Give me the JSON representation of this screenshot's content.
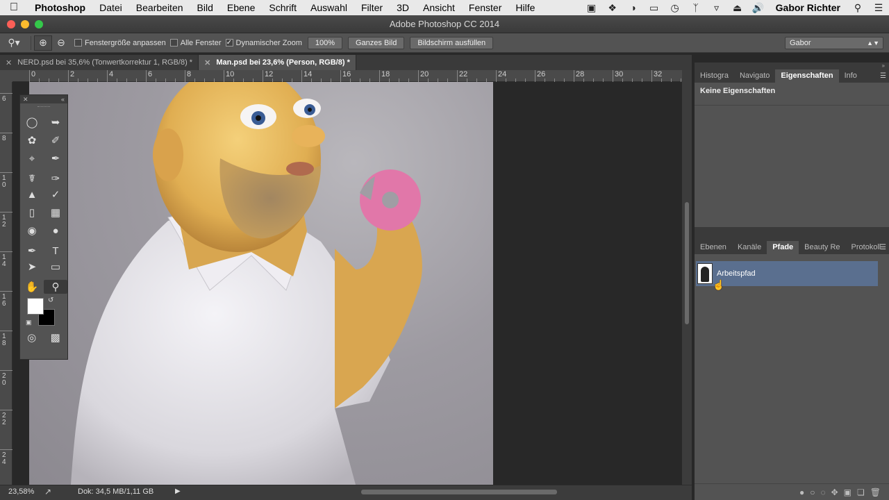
{
  "menubar": {
    "app": "Photoshop",
    "items": [
      "Datei",
      "Bearbeiten",
      "Bild",
      "Ebene",
      "Schrift",
      "Auswahl",
      "Filter",
      "3D",
      "Ansicht",
      "Fenster",
      "Hilfe"
    ],
    "user": "Gabor Richter",
    "tray_icons": [
      "menu-extra-icon",
      "dropbox-icon",
      "sync-icon",
      "airplay-icon",
      "time-machine-icon",
      "bluetooth-icon",
      "wifi-icon",
      "eject-icon",
      "volume-icon"
    ]
  },
  "window": {
    "title": "Adobe Photoshop CC 2014"
  },
  "options": {
    "fit_window": "Fenstergröße anpassen",
    "all_windows": "Alle Fenster",
    "dynamic_zoom": "Dynamischer Zoom",
    "zoom_value": "100%",
    "fit_screen": "Ganzes Bild",
    "fill_screen": "Bildschirm ausfüllen",
    "workspace": "Gabor"
  },
  "tabs": [
    {
      "label": "NERD.psd bei 35,6% (Tonwertkorrektur 1, RGB/8) *"
    },
    {
      "label": "Man.psd bei 23,6% (Person, RGB/8) *"
    }
  ],
  "ruler": {
    "top": [
      "0",
      "2",
      "4",
      "6",
      "8",
      "10",
      "12",
      "14",
      "16",
      "18",
      "20",
      "22",
      "24",
      "26",
      "28",
      "30",
      "32"
    ],
    "left": [
      "6",
      "8",
      "10",
      "12",
      "14",
      "16",
      "18",
      "20",
      "22",
      "24"
    ]
  },
  "status": {
    "zoom": "23,58%",
    "doc": "Dok: 34,5 MB/1,11 GB"
  },
  "tools_panel": {
    "tools": [
      "elliptical-marquee",
      "move",
      "polygonal-lasso",
      "quick-selection",
      "crop",
      "eyedropper",
      "healing-brush",
      "brush",
      "clone-stamp",
      "history-brush",
      "eraser",
      "gradient",
      "blur",
      "dodge",
      "pen",
      "type",
      "path-selection",
      "rectangle",
      "hand",
      "zoom"
    ]
  },
  "props_panel": {
    "tabs": [
      "Histogra",
      "Navigato",
      "Eigenschaften",
      "Info"
    ],
    "active": "Eigenschaften",
    "body": "Keine Eigenschaften"
  },
  "paths_panel": {
    "tabs": [
      "Ebenen",
      "Kanäle",
      "Pfade",
      "Beauty Re",
      "Protokoll"
    ],
    "active": "Pfade",
    "rows": [
      {
        "name": "Arbeitspfad"
      }
    ]
  },
  "colors": {
    "foreground": "#ffffff",
    "background": "#000000",
    "selected_path_row": "#5a6f8f"
  }
}
